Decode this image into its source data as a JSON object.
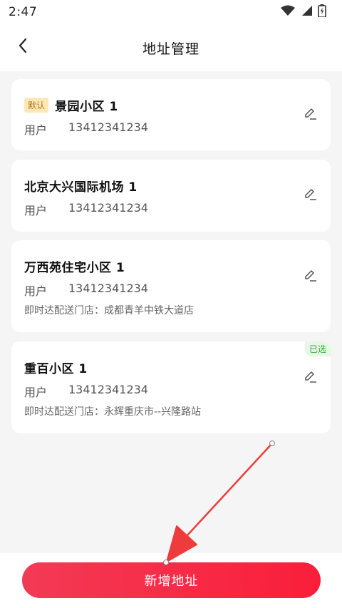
{
  "status_bar": {
    "time": "2:47"
  },
  "nav": {
    "title": "地址管理"
  },
  "addresses": [
    {
      "default_badge": "默认",
      "title": "景园小区 1",
      "user": "用户",
      "phone": "13412341234",
      "store": ""
    },
    {
      "title": "北京大兴国际机场 1",
      "user": "用户",
      "phone": "13412341234",
      "store": ""
    },
    {
      "title": "万西苑住宅小区 1",
      "user": "用户",
      "phone": "13412341234",
      "store": "即时达配送门店：成都青羊中铁大道店"
    },
    {
      "selected_badge": "已选",
      "title": "重百小区 1",
      "user": "用户",
      "phone": "13412341234",
      "store": "即时达配送门店：永辉重庆市--兴隆路站"
    }
  ],
  "footer": {
    "add_button_label": "新增地址"
  },
  "colors": {
    "accent": "#fa1e3a",
    "default_badge_bg": "#fde7b7",
    "selected_badge_text": "#3aa63a"
  }
}
